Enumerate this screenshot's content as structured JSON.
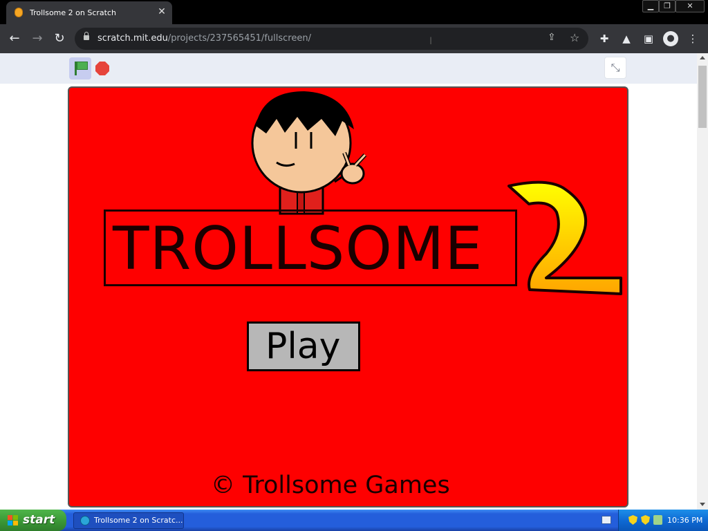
{
  "browser": {
    "tab_title": "Trollsome 2 on Scratch",
    "tab_close": "✕",
    "url_host": "scratch.mit.edu",
    "url_path": "/projects/237565451/fullscreen/"
  },
  "game": {
    "title": "TROLLSOME",
    "title_number": "2",
    "play_label": "Play",
    "copyright": "© Trollsome Games",
    "stage_color": "#fe0000"
  },
  "taskbar": {
    "start_label": "start",
    "task_label": "Trollsome 2 on Scratc...",
    "clock": "10:36 PM"
  },
  "icons": {
    "favicon": "scratch-cat-icon",
    "flag": "green-flag-icon",
    "stop": "stop-sign-icon",
    "unfullscreen": "collapse-icon"
  }
}
